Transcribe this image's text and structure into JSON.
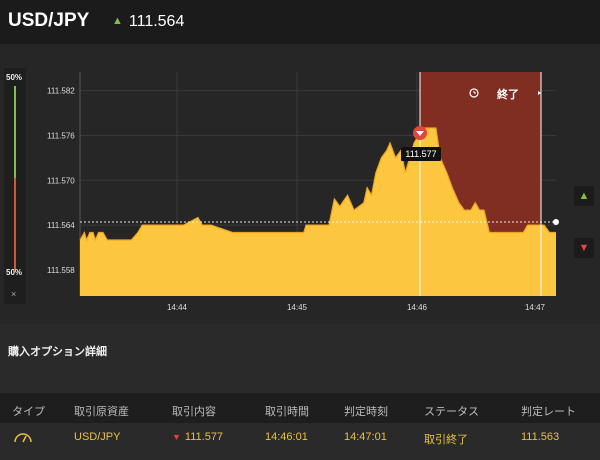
{
  "header": {
    "pair": "USD/JPY",
    "current_rate": "111.564",
    "trend_icon": "arrow-up-icon"
  },
  "chart_data": {
    "type": "area",
    "x_ticks": [
      "14:44",
      "14:45",
      "14:46",
      "14:47"
    ],
    "y_ticks": [
      "111.582",
      "111.576",
      "111.570",
      "111.564",
      "111.558"
    ],
    "ylim": [
      111.5545,
      111.5845
    ],
    "current_price": 111.564,
    "entry_marker": {
      "label": "111.577",
      "value": 111.577
    },
    "expiry_label": "終了",
    "gauge_top": "50%",
    "gauge_bottom": "50%",
    "close_label": "×",
    "series": [
      {
        "values": [
          [
            0,
            111.562
          ],
          [
            4,
            111.563
          ],
          [
            6,
            111.562
          ],
          [
            9,
            111.563
          ],
          [
            12,
            111.563
          ],
          [
            14,
            111.562
          ],
          [
            17,
            111.563
          ],
          [
            21,
            111.563
          ],
          [
            25,
            111.562
          ],
          [
            30,
            111.562
          ],
          [
            40,
            111.562
          ],
          [
            47,
            111.562
          ],
          [
            53,
            111.563
          ],
          [
            57,
            111.564
          ],
          [
            70,
            111.564
          ],
          [
            80,
            111.564
          ],
          [
            95,
            111.564
          ],
          [
            108,
            111.565
          ],
          [
            112,
            111.564
          ],
          [
            120,
            111.564
          ],
          [
            140,
            111.563
          ],
          [
            160,
            111.563
          ],
          [
            175,
            111.563
          ],
          [
            190,
            111.563
          ],
          [
            205,
            111.563
          ],
          [
            207,
            111.564
          ],
          [
            218,
            111.564
          ],
          [
            228,
            111.564
          ],
          [
            233,
            111.5675
          ],
          [
            238,
            111.5665
          ],
          [
            245,
            111.568
          ],
          [
            251,
            111.566
          ],
          [
            260,
            111.567
          ],
          [
            263,
            111.569
          ],
          [
            267,
            111.568
          ],
          [
            271,
            111.571
          ],
          [
            276,
            111.573
          ],
          [
            281,
            111.574
          ],
          [
            284,
            111.575
          ],
          [
            289,
            111.573
          ],
          [
            294,
            111.574
          ],
          [
            298,
            111.571
          ],
          [
            302,
            111.573
          ],
          [
            306,
            111.575
          ],
          [
            310,
            111.576
          ],
          [
            316,
            111.577
          ],
          [
            322,
            111.577
          ],
          [
            326,
            111.577
          ],
          [
            330,
            111.573
          ],
          [
            336,
            111.571
          ],
          [
            341,
            111.569
          ],
          [
            347,
            111.567
          ],
          [
            352,
            111.566
          ],
          [
            358,
            111.566
          ],
          [
            362,
            111.567
          ],
          [
            366,
            111.566
          ],
          [
            370,
            111.566
          ],
          [
            375,
            111.563
          ],
          [
            380,
            111.563
          ],
          [
            390,
            111.563
          ],
          [
            400,
            111.563
          ],
          [
            406,
            111.563
          ],
          [
            410,
            111.564
          ],
          [
            418,
            111.564
          ],
          [
            425,
            111.564
          ],
          [
            430,
            111.563
          ],
          [
            436,
            111.563
          ]
        ]
      }
    ]
  },
  "section_title": "購入オプション詳細",
  "table": {
    "headers": [
      "タイプ",
      "取引原資産",
      "取引内容",
      "取引時間",
      "判定時刻",
      "ステータス",
      "判定レート"
    ],
    "row": {
      "type_icon": "gauge-icon",
      "asset": "USD/JPY",
      "direction_icon": "arrow-down-icon",
      "content": "111.577",
      "trade_time": "14:46:01",
      "judge_time": "14:47:01",
      "status": "取引終了",
      "judge_rate": "111.563"
    }
  }
}
